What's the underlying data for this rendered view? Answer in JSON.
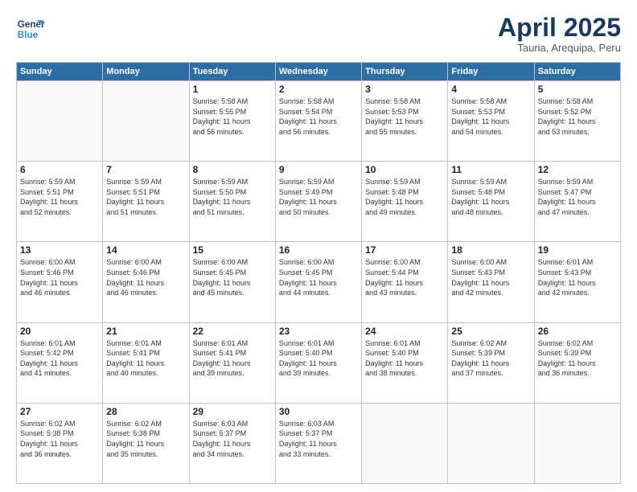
{
  "header": {
    "logo_line1": "General",
    "logo_line2": "Blue",
    "title": "April 2025",
    "subtitle": "Tauria, Arequipa, Peru"
  },
  "weekdays": [
    "Sunday",
    "Monday",
    "Tuesday",
    "Wednesday",
    "Thursday",
    "Friday",
    "Saturday"
  ],
  "weeks": [
    [
      {
        "day": "",
        "info": ""
      },
      {
        "day": "",
        "info": ""
      },
      {
        "day": "1",
        "info": "Sunrise: 5:58 AM\nSunset: 5:55 PM\nDaylight: 11 hours\nand 56 minutes."
      },
      {
        "day": "2",
        "info": "Sunrise: 5:58 AM\nSunset: 5:54 PM\nDaylight: 11 hours\nand 56 minutes."
      },
      {
        "day": "3",
        "info": "Sunrise: 5:58 AM\nSunset: 5:53 PM\nDaylight: 11 hours\nand 55 minutes."
      },
      {
        "day": "4",
        "info": "Sunrise: 5:58 AM\nSunset: 5:53 PM\nDaylight: 11 hours\nand 54 minutes."
      },
      {
        "day": "5",
        "info": "Sunrise: 5:58 AM\nSunset: 5:52 PM\nDaylight: 11 hours\nand 53 minutes."
      }
    ],
    [
      {
        "day": "6",
        "info": "Sunrise: 5:59 AM\nSunset: 5:51 PM\nDaylight: 11 hours\nand 52 minutes."
      },
      {
        "day": "7",
        "info": "Sunrise: 5:59 AM\nSunset: 5:51 PM\nDaylight: 11 hours\nand 51 minutes."
      },
      {
        "day": "8",
        "info": "Sunrise: 5:59 AM\nSunset: 5:50 PM\nDaylight: 11 hours\nand 51 minutes."
      },
      {
        "day": "9",
        "info": "Sunrise: 5:59 AM\nSunset: 5:49 PM\nDaylight: 11 hours\nand 50 minutes."
      },
      {
        "day": "10",
        "info": "Sunrise: 5:59 AM\nSunset: 5:48 PM\nDaylight: 11 hours\nand 49 minutes."
      },
      {
        "day": "11",
        "info": "Sunrise: 5:59 AM\nSunset: 5:48 PM\nDaylight: 11 hours\nand 48 minutes."
      },
      {
        "day": "12",
        "info": "Sunrise: 5:59 AM\nSunset: 5:47 PM\nDaylight: 11 hours\nand 47 minutes."
      }
    ],
    [
      {
        "day": "13",
        "info": "Sunrise: 6:00 AM\nSunset: 5:46 PM\nDaylight: 11 hours\nand 46 minutes."
      },
      {
        "day": "14",
        "info": "Sunrise: 6:00 AM\nSunset: 5:46 PM\nDaylight: 11 hours\nand 46 minutes."
      },
      {
        "day": "15",
        "info": "Sunrise: 6:00 AM\nSunset: 5:45 PM\nDaylight: 11 hours\nand 45 minutes."
      },
      {
        "day": "16",
        "info": "Sunrise: 6:00 AM\nSunset: 5:45 PM\nDaylight: 11 hours\nand 44 minutes."
      },
      {
        "day": "17",
        "info": "Sunrise: 6:00 AM\nSunset: 5:44 PM\nDaylight: 11 hours\nand 43 minutes."
      },
      {
        "day": "18",
        "info": "Sunrise: 6:00 AM\nSunset: 5:43 PM\nDaylight: 11 hours\nand 42 minutes."
      },
      {
        "day": "19",
        "info": "Sunrise: 6:01 AM\nSunset: 5:43 PM\nDaylight: 11 hours\nand 42 minutes."
      }
    ],
    [
      {
        "day": "20",
        "info": "Sunrise: 6:01 AM\nSunset: 5:42 PM\nDaylight: 11 hours\nand 41 minutes."
      },
      {
        "day": "21",
        "info": "Sunrise: 6:01 AM\nSunset: 5:41 PM\nDaylight: 11 hours\nand 40 minutes."
      },
      {
        "day": "22",
        "info": "Sunrise: 6:01 AM\nSunset: 5:41 PM\nDaylight: 11 hours\nand 39 minutes."
      },
      {
        "day": "23",
        "info": "Sunrise: 6:01 AM\nSunset: 5:40 PM\nDaylight: 11 hours\nand 39 minutes."
      },
      {
        "day": "24",
        "info": "Sunrise: 6:01 AM\nSunset: 5:40 PM\nDaylight: 11 hours\nand 38 minutes."
      },
      {
        "day": "25",
        "info": "Sunrise: 6:02 AM\nSunset: 5:39 PM\nDaylight: 11 hours\nand 37 minutes."
      },
      {
        "day": "26",
        "info": "Sunrise: 6:02 AM\nSunset: 5:39 PM\nDaylight: 11 hours\nand 36 minutes."
      }
    ],
    [
      {
        "day": "27",
        "info": "Sunrise: 6:02 AM\nSunset: 5:38 PM\nDaylight: 11 hours\nand 36 minutes."
      },
      {
        "day": "28",
        "info": "Sunrise: 6:02 AM\nSunset: 5:38 PM\nDaylight: 11 hours\nand 35 minutes."
      },
      {
        "day": "29",
        "info": "Sunrise: 6:03 AM\nSunset: 5:37 PM\nDaylight: 11 hours\nand 34 minutes."
      },
      {
        "day": "30",
        "info": "Sunrise: 6:03 AM\nSunset: 5:37 PM\nDaylight: 11 hours\nand 33 minutes."
      },
      {
        "day": "",
        "info": ""
      },
      {
        "day": "",
        "info": ""
      },
      {
        "day": "",
        "info": ""
      }
    ]
  ]
}
